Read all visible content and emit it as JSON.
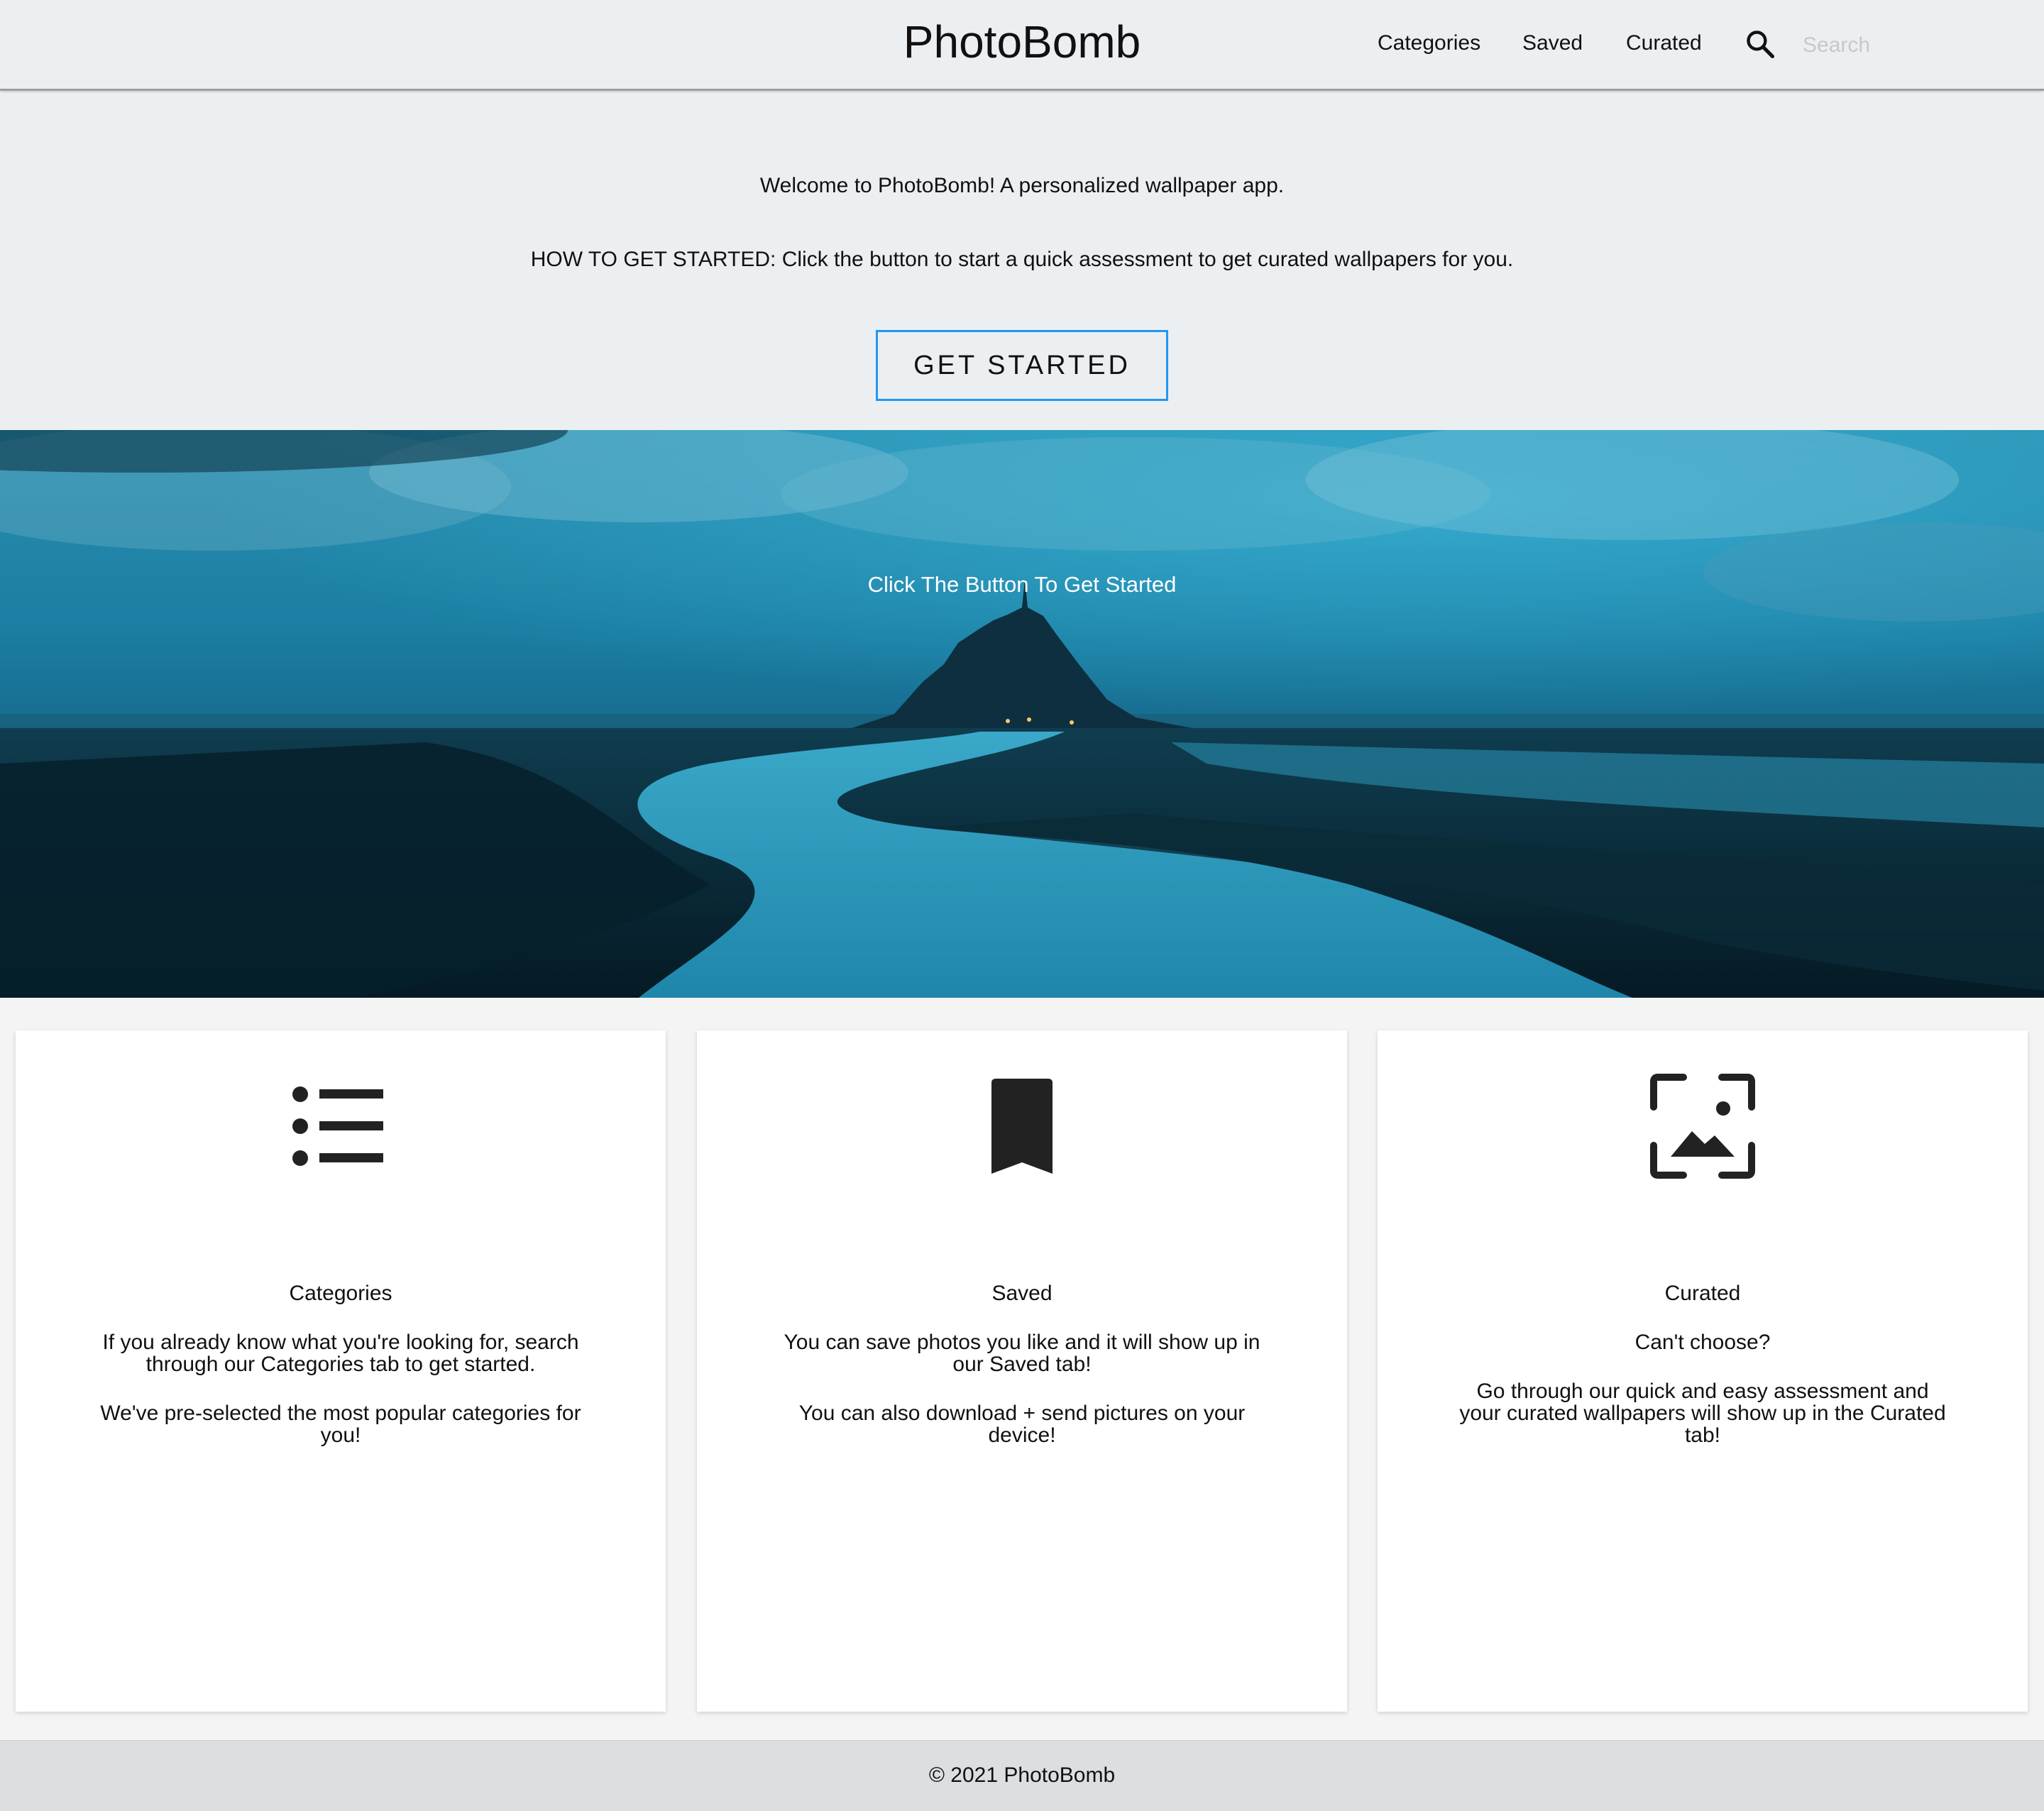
{
  "header": {
    "brand": "PhotoBomb",
    "nav": [
      "Categories",
      "Saved",
      "Curated"
    ],
    "search_placeholder": "Search",
    "search_icon": "search-icon"
  },
  "intro": {
    "welcome": "Welcome to PhotoBomb! A personalized wallpaper app.",
    "howto": "HOW TO GET STARTED: Click the button to start a quick assessment to get curated wallpapers for you.",
    "button_label": "GET STARTED",
    "button_border_color": "#2196f3"
  },
  "hero": {
    "caption": "Click The Button To Get Started"
  },
  "cards": [
    {
      "icon": "list-icon",
      "title": "Categories",
      "paragraphs": [
        "If you already know what you're looking for, search through our Categories tab to get started.",
        "We've pre-selected the most popular categories for you!"
      ]
    },
    {
      "icon": "bookmark-icon",
      "title": "Saved",
      "paragraphs": [
        "You can save photos you like and it will show up in our Saved tab!",
        "You can also download + send pictures on your device!"
      ]
    },
    {
      "icon": "photo-frame-icon",
      "title": "Curated",
      "paragraphs": [
        "Can't choose?",
        "Go through our quick and easy assessment and your curated wallpapers will show up in the Curated tab!"
      ]
    }
  ],
  "footer": {
    "copyright": "© 2021 PhotoBomb"
  }
}
